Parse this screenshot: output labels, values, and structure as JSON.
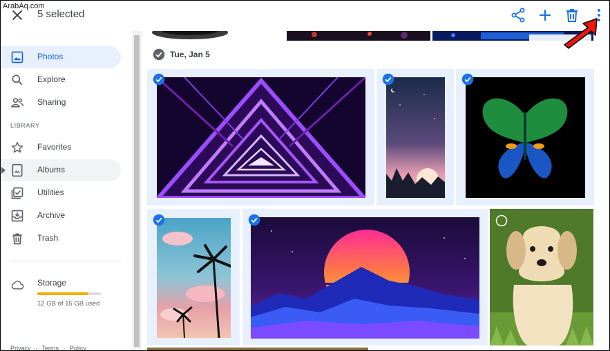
{
  "watermark": "ArabAq.com",
  "topbar": {
    "selection_count_label": "5 selected",
    "icons": [
      "close-icon",
      "share-icon",
      "add-icon",
      "trash-icon",
      "more-vert-icon"
    ]
  },
  "sidebar": {
    "items": [
      {
        "label": "Photos",
        "icon": "photo-icon",
        "active": true
      },
      {
        "label": "Explore",
        "icon": "search-icon"
      },
      {
        "label": "Sharing",
        "icon": "people-icon"
      }
    ],
    "library_header": "LIBRARY",
    "library_items": [
      {
        "label": "Favorites",
        "icon": "star-icon"
      },
      {
        "label": "Albums",
        "icon": "album-icon"
      },
      {
        "label": "Utilities",
        "icon": "utilities-icon"
      },
      {
        "label": "Archive",
        "icon": "archive-icon"
      },
      {
        "label": "Trash",
        "icon": "trash-icon"
      }
    ],
    "storage": {
      "title": "Storage",
      "usage_text": "12 GB of 15 GB used",
      "used_fraction": 0.8,
      "bar_color": "#f9ab00"
    },
    "footer_links": [
      "Privacy",
      "·",
      "Terms",
      "·",
      "Policy"
    ]
  },
  "content": {
    "date_label": "Tue, Jan 5",
    "photos": [
      {
        "subject": "purple neon triangle tunnel",
        "selected": true
      },
      {
        "subject": "mountain sunset with moon",
        "selected": true
      },
      {
        "subject": "colorful butterfly on black",
        "selected": true
      },
      {
        "subject": "palm trees at pink sunset",
        "selected": true
      },
      {
        "subject": "synthwave sun over mountains",
        "selected": true
      },
      {
        "subject": "golden retriever puppy",
        "selected": false
      }
    ]
  },
  "colors": {
    "accent": "#1a73e8",
    "selected_bg": "#e8f0fe",
    "arrow": "#e8170c"
  }
}
